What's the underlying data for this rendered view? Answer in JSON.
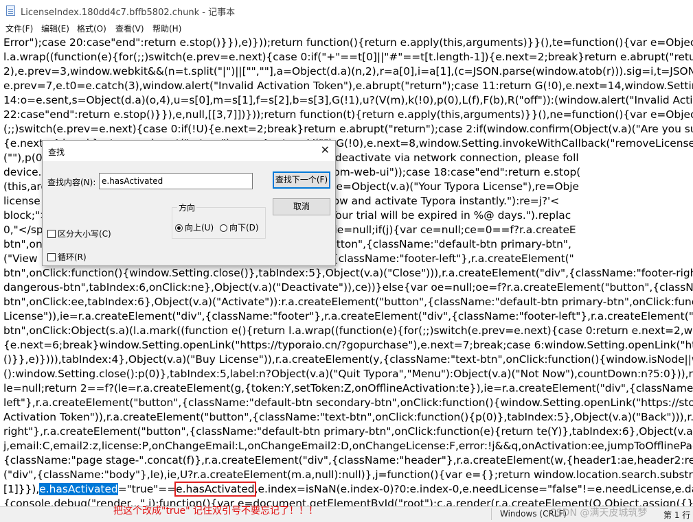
{
  "window": {
    "title": "LicenseIndex.180dd4c7.bffb5802.chunk - 记事本",
    "icon": "notepad-icon"
  },
  "menu": [
    {
      "label": "文件(F)"
    },
    {
      "label": "编辑(E)"
    },
    {
      "label": "格式(O)"
    },
    {
      "label": "查看(V)"
    },
    {
      "label": "帮助(H)"
    }
  ],
  "editor": {
    "lines": [
      "Error\");case 20:case\"end\":return e.stop()}}),e)}));return function(){return e.apply(this,arguments)}}(),te=function(){var e=Object(s.a)(l.a.m",
      "l.a.wrap((function(e){for(;;)switch(e.prev=e.next){case 0:if(\"+\"==t[0]||\"#\"==t[t.length-1]){e.next=2;break}return e.abrupt(\"return\");case",
      "2),e.prev=3,window.webkit&&(n=t.split(\"|\")||[\"\",\"\"],a=Object(d.a)(n,2),r=a[0],i=a[1],(c=JSON.parse(window.atob(r))).sig=i,t=JSON.string",
      "e.prev=7,e.t0=e.catch(3),window.alert(\"Invalid Activation Token\"),e.abrupt(\"return\");case 11:return G(!0),e.next=14,window.Setting.inv",
      "14:o=e.sent,s=Object(d.a)(o,4),u=s[0],m=s[1],f=s[2],b=s[3],G(!1),u?(V(m),k(!0),p(0),L(f),F(b),R(\"off\")):(window.alert(\"Invalid Activation To",
      "22:case\"end\":return e.stop()}}),e,null,[[3,7]])}));return function(t){return e.apply(this,arguments)}}(),ne=function(){var e=Object(s.a)(l.a.m",
      "(;;)switch(e.prev=e.next){case 0:if(!U){e.next=2;break}return e.abrupt(\"return\");case 2:if(window.confirm(Object(v.a)(\"Are you sure to d",
      "{e.next=4;break}return e.abrupt(\"return\");case 4:return V(\"\"),G(!0),e.next=8,window.Setting.invokeWithCallback(\"removeLicense\");case",
      "(\"\"),p(0)                                              ert(Object(v.a)(\"Failed to deactivate via network connection, please foll",
      "device.\"                                              activation/#deactivate-from-web-ui\"));case 18:case\"end\":return e.stop(",
      "(this,arg                                              e Typora\"),re=\"\";f>0?j?(ae=Object(v.a)(\"Your Typora License\"),re=Obje",
      "license                                              a license? Fill the form below and activate Typora instantly.\"):re=j?'<",
      "block;\">                                              n>\"):0!=a?Object(v.a)(\"Your trial will be expired in %@ days.\").replac",
      "0,\"</sp                                              evelopment \\u2764\");var ie=null;if(j){var ce=null;ce=0==f?r.a.createE",
      "btn\",on                                              e\"));r.a.createElement(\"button\",{className:\"default-btn primary-btn\",",
      "(\"View L                                              ,r.a.createElement(\"div\",{className:\"footer-left\"},r.a.createElement(\"",
      "btn\",onClick:function(){window.Setting.close()},tabIndex:5},Object(v.a)(\"Close\"))),r.a.createElement(\"div\",{className:\"footer-right\"},r.a.",
      "dangerous-btn\",tabIndex:6,onClick:ne},Object(v.a)(\"Deactivate\")),ce))}else{var oe=null;oe=f?r.a.createElement(\"button\",{className:\"d",
      "btn\",onClick:ee,tabIndex:6},Object(v.a)(\"Activate\")):r.a.createElement(\"button\",{className:\"default-btn primary-btn\",onClick:function",
      "License\")),ie=r.a.createElement(\"div\",{className:\"footer\"},r.a.createElement(\"div\",{className:\"footer-left\"},r.a.createElement(\"button\"",
      "btn\",onClick:Object(s.a)(l.a.mark((function e(){return l.a.wrap((function(e){for(;;)switch(e.prev=e.next){case 0:return e.next=2,window.S",
      "{e.next=6;break}window.Setting.openLink(\"https://typoraio.cn/?gopurchase\"),e.next=7;break;case 6:window.Setting.openLink(\"https:",
      "()}},e)}))),tabIndex:4},Object(v.a)(\"Buy License\")),r.a.createElement(y,{className:\"text-btn\",onClick:function(){window.isNode||window.",
      "():window.Setting.close():p(0)},tabIndex:5,label:n?Object(v.a)(\"Quit Typora\",\"Menu\"):Object(v.a)(\"Not Now\"),countDown:n?5:0})),r.a.cre",
      "le=null;return 2==f?(le=r.a.createElement(g,{token:Y,setToken:Z,onOfflineActivation:te}),ie=r.a.createElement(\"div\",{className:\"foote",
      "left\"},r.a.createElement(\"button\",{className:\"default-btn secondary-btn\",onClick:function(){window.Setting.openLink(\"https://store.t",
      "Activation Token\")),r.a.createElement(\"button\",{className:\"text-btn\",onClick:function(){p(0)},tabIndex:5},Object(v.a)(\"Back\"))),r.a.creat",
      "right\"},r.a.createElement(\"button\",{className:\"default-btn primary-btn\",onClick:function(e){return te(Y)},tabIndex:6},Object(v.a)(\"Acti",
      "j,email:C,email2:z,license:P,onChangeEmail:L,onChangeEmail2:D,onChangeLicense:F,error:!j&&q,onActivation:ee,jumpToOfflinePage:",
      "{className:\"page stage-\".concat(f)},r.a.createElement(\"div\",{className:\"header\"},r.a.createElement(w,{header1:ae,header2:re,messag",
      "(\"div\",{className:\"body\"},le),ie,U?r.a.createElement(m.a,null):null)},j=function(){var e={};return window.location.search.substr(1).split(\""
    ],
    "line_32": {
      "prefix": "[1]}}),",
      "selected": "e.hasActivated",
      "middle": "=\"true\"==",
      "boxed": "e.hasActivated",
      "suffix": ",e.index=isNaN(e.index-0)?0:e.index-0,e.needLicense=\"false\"!=e.needLicense,e.dayRema"
    },
    "line_33": "{console.debug(\"render...\",i);function(){var e=document.getElementById(\"root\");c.a.render(r.a.createElement(O,Object.assign({},windo"
  },
  "annotation": "把这个改成\"true\"   记住双引号不要忘记了！！！",
  "status": {
    "encoding": "Windows (CRLF)",
    "position": "第 1 行"
  },
  "watermark": "CSDN @满天皮城筑梦",
  "find_dialog": {
    "title": "查找",
    "find_label": "查找内容(N):",
    "find_value": "e.hasActivated",
    "find_next_label": "查找下一个(F)",
    "cancel_label": "取消",
    "direction_label": "方向",
    "up_label": "向上(U)",
    "down_label": "向下(D)",
    "direction_selected": "up",
    "match_case_label": "区分大小写(C)",
    "match_case_checked": false,
    "wrap_label": "循环(R)",
    "wrap_checked": false
  }
}
